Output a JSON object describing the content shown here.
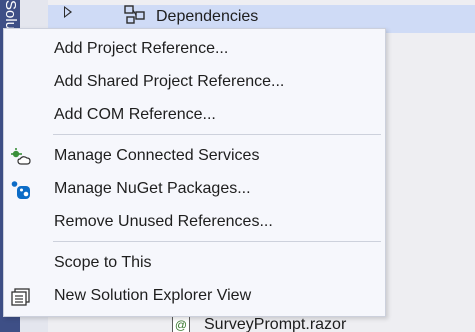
{
  "side_tab": {
    "label": "Solution Explorer"
  },
  "tree": {
    "dependencies_label": "Dependencies",
    "survey_label": "SurveyPrompt.razor",
    "razor_icon_glyph": "@"
  },
  "menu": {
    "items": [
      {
        "label": "Add Project Reference...",
        "icon": ""
      },
      {
        "label": "Add Shared Project Reference...",
        "icon": ""
      },
      {
        "label": "Add COM Reference...",
        "icon": ""
      },
      {
        "label": "Manage Connected Services",
        "icon": "connected-services-icon"
      },
      {
        "label": "Manage NuGet Packages...",
        "icon": "nuget-icon"
      },
      {
        "label": "Remove Unused References...",
        "icon": ""
      },
      {
        "label": "Scope to This",
        "icon": ""
      },
      {
        "label": "New Solution Explorer View",
        "icon": "new-view-icon"
      }
    ]
  },
  "colors": {
    "side_tab": "#3e4f86",
    "selection": "#cfdbf6",
    "menu_background": "#f6f7fc",
    "nuget_blue": "#0c6cc7"
  }
}
